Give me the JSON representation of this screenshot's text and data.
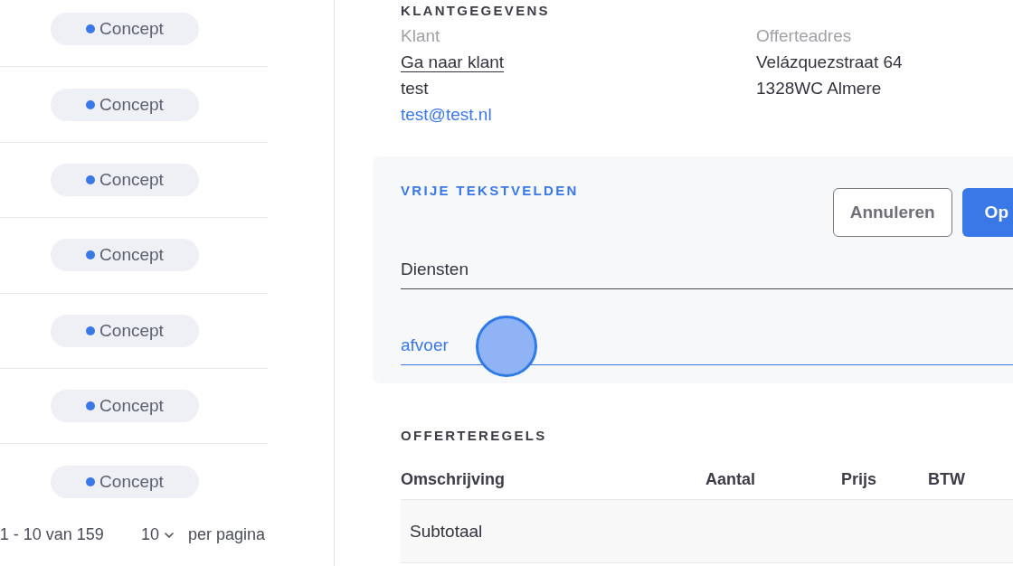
{
  "quotes_list": {
    "rows": [
      {
        "status": {
          "label": "Concept",
          "color": "#3b78e7"
        }
      },
      {
        "status": {
          "label": "Concept",
          "color": "#3b78e7"
        }
      },
      {
        "status": {
          "label": "Concept",
          "color": "#3b78e7"
        }
      },
      {
        "status": {
          "label": "Concept",
          "color": "#3b78e7"
        }
      },
      {
        "status": {
          "label": "Concept",
          "color": "#3b78e7"
        }
      },
      {
        "status": {
          "label": "Concept",
          "color": "#3b78e7"
        }
      },
      {
        "status": {
          "label": "Concept",
          "color": "#3b78e7"
        }
      }
    ],
    "pagination": {
      "range": "1 - 10 van 159",
      "per_page": "10",
      "per_page_label": "per pagina"
    }
  },
  "customer_details": {
    "title": "KLANTGEGEVENS",
    "customer": {
      "label": "Klant",
      "link": "Ga naar klant",
      "name": "test",
      "email": "test@test.nl"
    },
    "quote_address": {
      "label": "Offerteadres",
      "lines": [
        "Velázquezstraat 64",
        "1328WC Almere"
      ]
    }
  },
  "free_text_fields": {
    "title": "VRIJE TEKSTVELDEN",
    "buttons": [
      {
        "label": "Annuleren",
        "kind": "secondary"
      },
      {
        "label": "Op",
        "kind": "primary"
      }
    ],
    "fields": [
      {
        "value": "Diensten",
        "focused": false
      },
      {
        "value": "afvoer",
        "focused": true
      }
    ]
  },
  "quote_lines": {
    "title": "OFFERTEREGELS",
    "table": {
      "columns": [
        "Omschrijving",
        "Aantal",
        "Prijs",
        "BTW"
      ],
      "rows": [
        {
          "kind": "subtotal",
          "cells": [
            "Subtotaal"
          ]
        }
      ]
    }
  }
}
